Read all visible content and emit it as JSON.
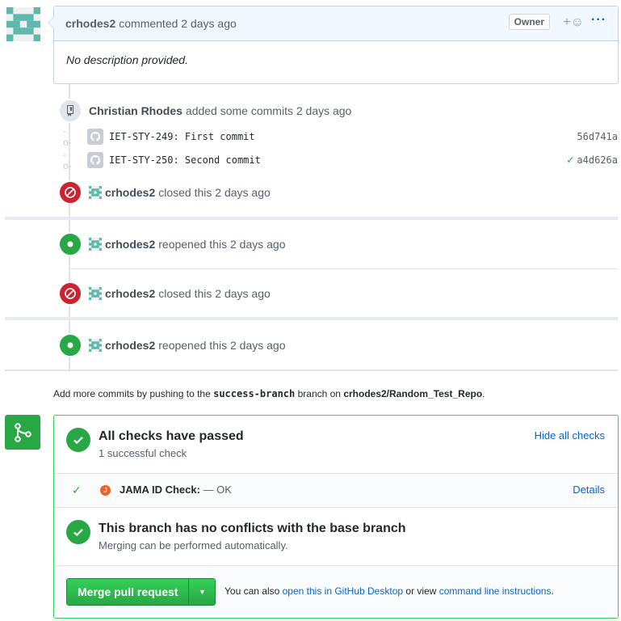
{
  "comment": {
    "author": "crhodes2",
    "action": "commented 2 days ago",
    "role_badge": "Owner",
    "reaction_icon": "+☺",
    "more_icon": "···",
    "body": "No description provided."
  },
  "commits_event": {
    "actor": "Christian Rhodes",
    "action": "added some commits 2 days ago",
    "commits": [
      {
        "message": "IET-STY-249: First commit",
        "sha": "56d741a",
        "status": ""
      },
      {
        "message": "IET-STY-250: Second commit",
        "sha": "a4d626a",
        "status": "success"
      }
    ]
  },
  "events": [
    {
      "actor": "crhodes2",
      "action": "closed this 2 days ago",
      "type": "closed"
    },
    {
      "actor": "crhodes2",
      "action": "reopened this 2 days ago",
      "type": "reopened"
    },
    {
      "actor": "crhodes2",
      "action": "closed this 2 days ago",
      "type": "closed"
    },
    {
      "actor": "crhodes2",
      "action": "reopened this 2 days ago",
      "type": "reopened"
    }
  ],
  "push_note": {
    "prefix": "Add more commits by pushing to the",
    "branch": "success-branch",
    "middle": "branch on",
    "repo": "crhodes2/Random_Test_Repo",
    "suffix": "."
  },
  "mergebox": {
    "checks_title": "All checks have passed",
    "checks_sub": "1 successful check",
    "hide_checks": "Hide all checks",
    "check_name": "JAMA ID Check:",
    "check_result": "— OK",
    "check_icon_letter": "J",
    "details": "Details",
    "conflict_title": "This branch has no conflicts with the base branch",
    "conflict_sub": "Merging can be performed automatically.",
    "merge_button": "Merge pull request",
    "footer_prefix": "You can also",
    "footer_link1": "open this in GitHub Desktop",
    "footer_middle": "or view",
    "footer_link2": "command line instructions",
    "footer_suffix": "."
  },
  "colors": {
    "green": "#28a745",
    "red": "#cb2431",
    "link": "#0366d6",
    "identicon": "#5fb8ac"
  }
}
